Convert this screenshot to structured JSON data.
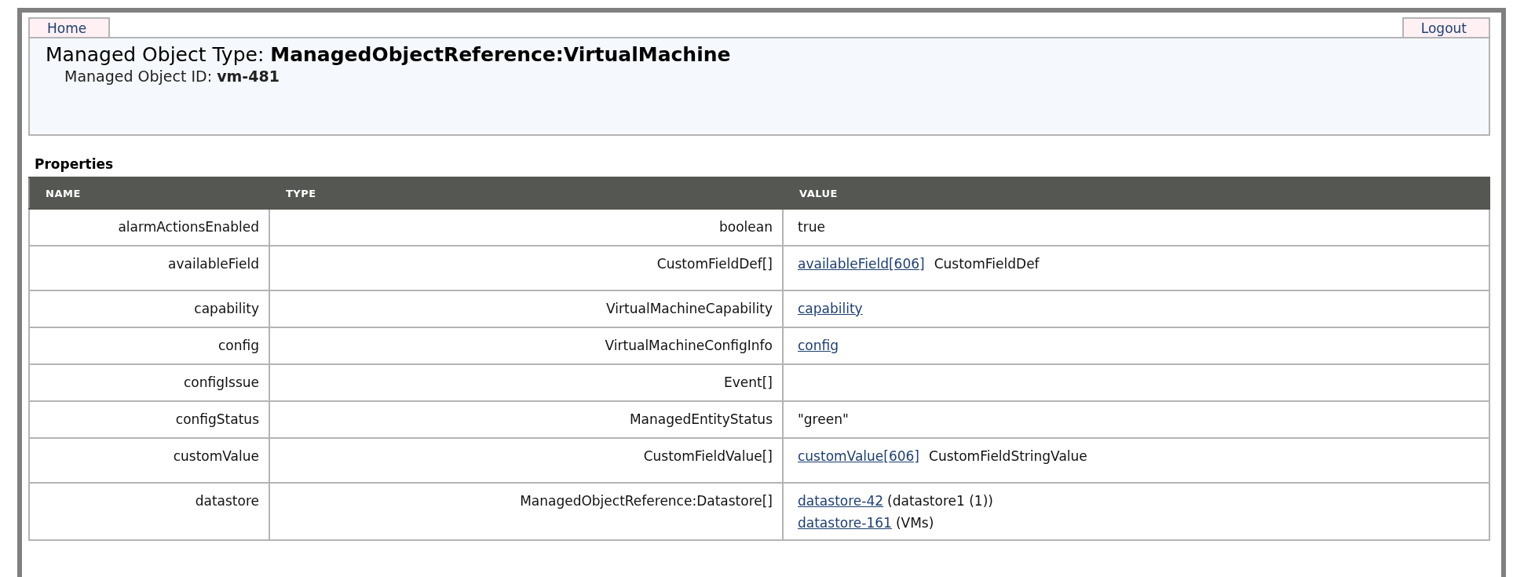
{
  "nav": {
    "home": "Home",
    "logout": "Logout"
  },
  "header": {
    "type_label": "Managed Object Type:",
    "type_value": "ManagedObjectReference:VirtualMachine",
    "id_label": "Managed Object ID:",
    "id_value": "vm-481"
  },
  "section_title": "Properties",
  "table": {
    "columns": [
      "NAME",
      "TYPE",
      "VALUE"
    ],
    "rows": [
      {
        "name": "alarmActionsEnabled",
        "type": "boolean",
        "value": [
          {
            "text": "true"
          }
        ]
      },
      {
        "name": "availableField",
        "type": "CustomFieldDef[]",
        "value": [
          {
            "link": "availableField[606]",
            "text": "CustomFieldDef"
          }
        ]
      },
      {
        "name": "capability",
        "type": "VirtualMachineCapability",
        "value": [
          {
            "link": "capability"
          }
        ]
      },
      {
        "name": "config",
        "type": "VirtualMachineConfigInfo",
        "value": [
          {
            "link": "config"
          }
        ]
      },
      {
        "name": "configIssue",
        "type": "Event[]"
      },
      {
        "name": "configStatus",
        "type": "ManagedEntityStatus",
        "value": [
          {
            "text": "\"green\""
          }
        ]
      },
      {
        "name": "customValue",
        "type": "CustomFieldValue[]",
        "value": [
          {
            "link": "customValue[606]",
            "text": "CustomFieldStringValue"
          }
        ]
      },
      {
        "name": "datastore",
        "type": "ManagedObjectReference:Datastore[]",
        "value": [
          {
            "link": "datastore-42",
            "text": "(datastore1 (1))"
          },
          {
            "link": "datastore-161",
            "text": "(VMs)"
          }
        ]
      }
    ]
  }
}
